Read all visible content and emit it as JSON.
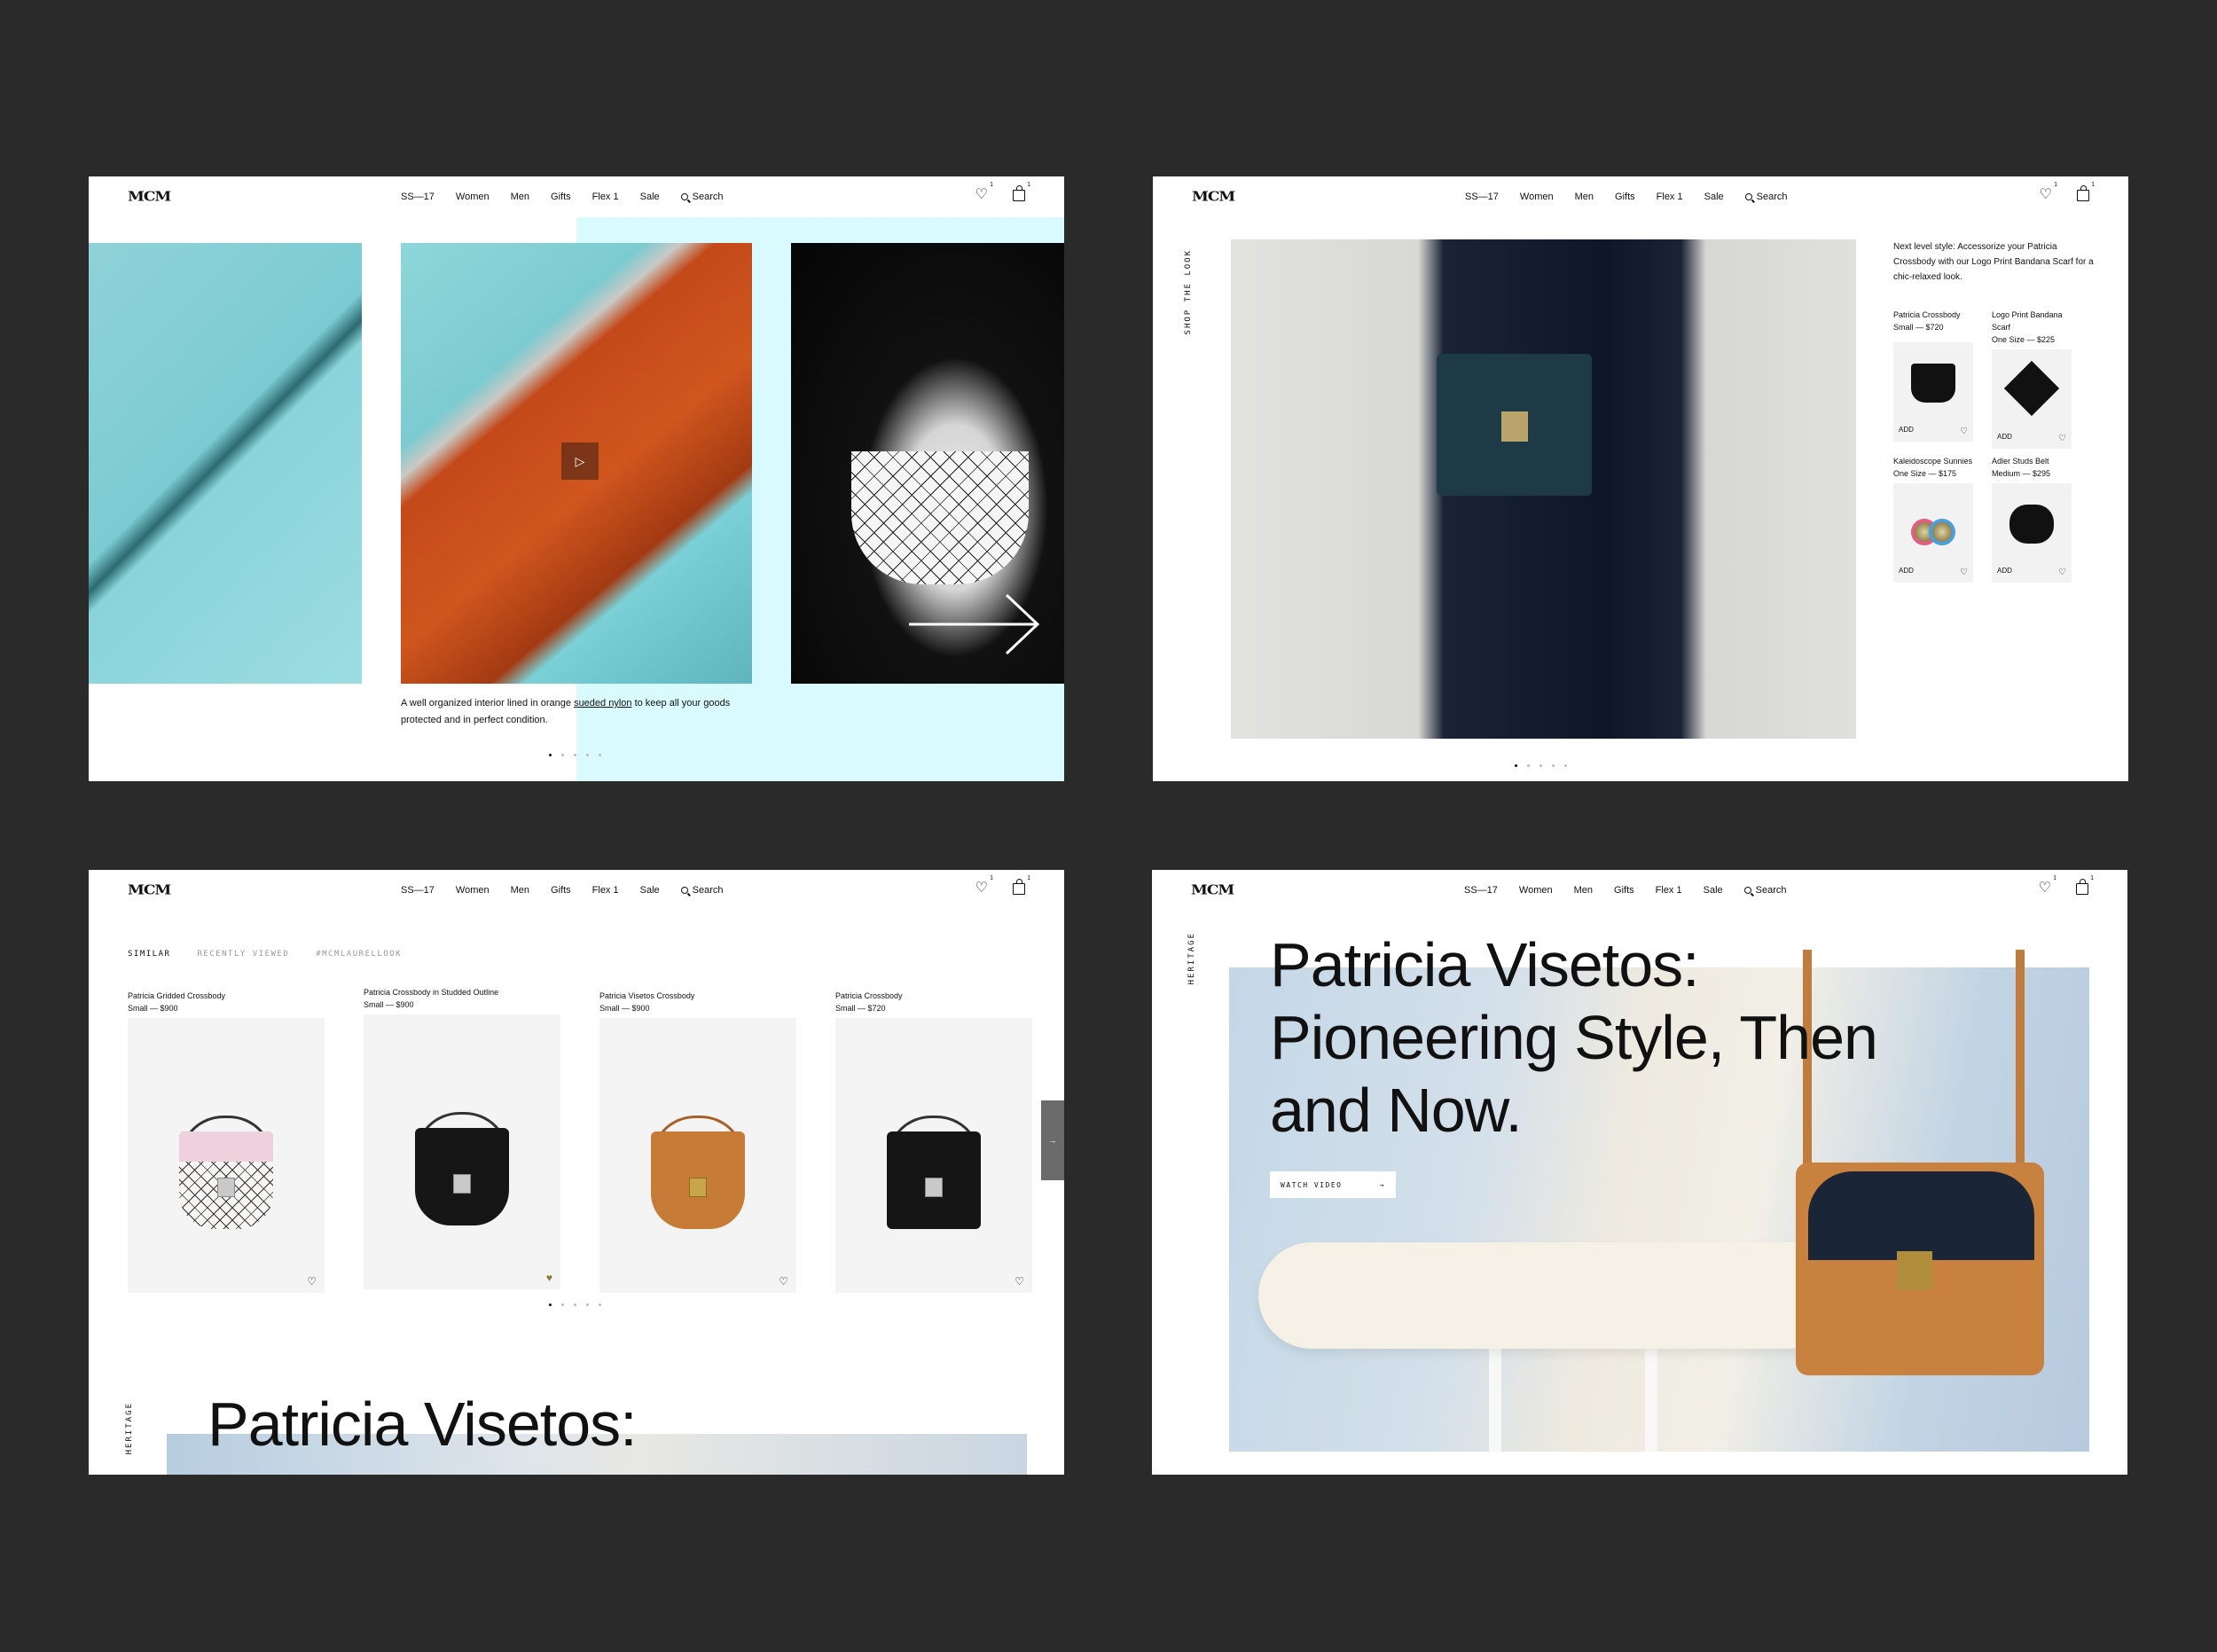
{
  "nav": {
    "logo": "MCM",
    "items": [
      "SS—17",
      "Women",
      "Men",
      "Gifts",
      "Flex 1",
      "Sale"
    ],
    "search_label": "Search",
    "wishlist_count": "1",
    "cart_count": "1"
  },
  "screen1": {
    "play_icon": "▷",
    "caption_pre": "A well organized interior lined in orange ",
    "caption_link": "sueded nylon",
    "caption_post": " to keep all your goods protected and in perfect condition.",
    "active_slide": 1,
    "slide_count": 5
  },
  "screen2": {
    "vertical_label": "SHOP THE LOOK",
    "description": "Next level style: Accessorize your Patricia Crossbody with our Logo Print Bandana Scarf for a chic-relaxed look.",
    "products": [
      {
        "name": "Patricia Crossbody",
        "detail": "Small — $720",
        "add": "ADD",
        "icon": "bag-icon"
      },
      {
        "name": "Logo Print Bandana Scarf",
        "detail": "One Size — $225",
        "add": "ADD",
        "icon": "scarf-icon"
      },
      {
        "name": "Kaleidoscope Sunnies",
        "detail": "One Size — $175",
        "add": "ADD",
        "icon": "sunglasses-icon"
      },
      {
        "name": "Adler Studs Belt",
        "detail": "Medium — $295",
        "add": "ADD",
        "icon": "belt-icon"
      }
    ],
    "active_slide": 1,
    "slide_count": 5
  },
  "screen3": {
    "tabs": [
      "SIMILAR",
      "RECENTLY VIEWED",
      "#MCMLAURELLOOK"
    ],
    "cards": [
      {
        "name": "Patricia Gridded Crossbody",
        "detail": "Small — $900",
        "color": "#f3f1ef",
        "flap": "#f1cfdc"
      },
      {
        "name": "Patricia Crossbody in Studded Outline",
        "detail": "Small — $900",
        "color": "#161616",
        "flap": "#161616"
      },
      {
        "name": "Patricia Visetos Crossbody",
        "detail": "Small — $900",
        "color": "#c67b36",
        "flap": "#c67b36"
      },
      {
        "name": "Patricia Crossbody",
        "detail": "Small — $720",
        "color": "#151515",
        "flap": "#151515"
      }
    ],
    "next_arrow": "→",
    "vertical_label": "HERITAGE",
    "teaser_title": "Patricia Visetos:",
    "active_slide": 1,
    "slide_count": 5
  },
  "screen4": {
    "vertical_label": "HERITAGE",
    "title": "Patricia Visetos: Pioneering Style, Then and Now.",
    "watch_label": "WATCH VIDEO",
    "watch_arrow": "→"
  }
}
